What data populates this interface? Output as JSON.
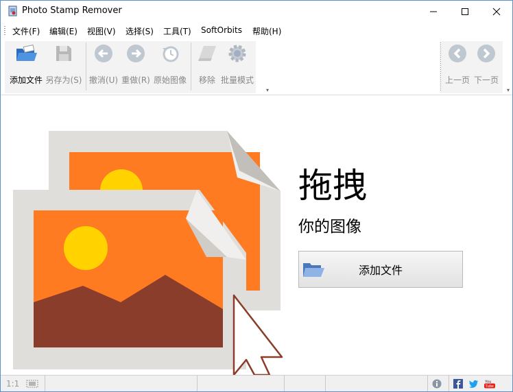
{
  "window": {
    "title": "Photo Stamp Remover"
  },
  "menu": [
    "文件(F)",
    "编辑(E)",
    "视图(V)",
    "选择(S)",
    "工具(T)",
    "SoftOrbits",
    "帮助(H)"
  ],
  "toolbar": {
    "add_file": "添加文件",
    "save_as": "另存为(S)",
    "undo": "撤消(U)",
    "redo": "重做(R)",
    "original": "原始图像",
    "remove": "移除",
    "batch": "批量模式",
    "prev": "上一页",
    "next": "下一页"
  },
  "main": {
    "drag_title": "拖拽",
    "drag_subtitle": "你的图像",
    "add_button": "添加文件"
  },
  "status": {
    "zoom": "1:1"
  },
  "colors": {
    "accent_orange": "#ff7b22",
    "sun": "#ffd200",
    "mountain": "#8a3d2a",
    "frame": "#e0dedb"
  }
}
